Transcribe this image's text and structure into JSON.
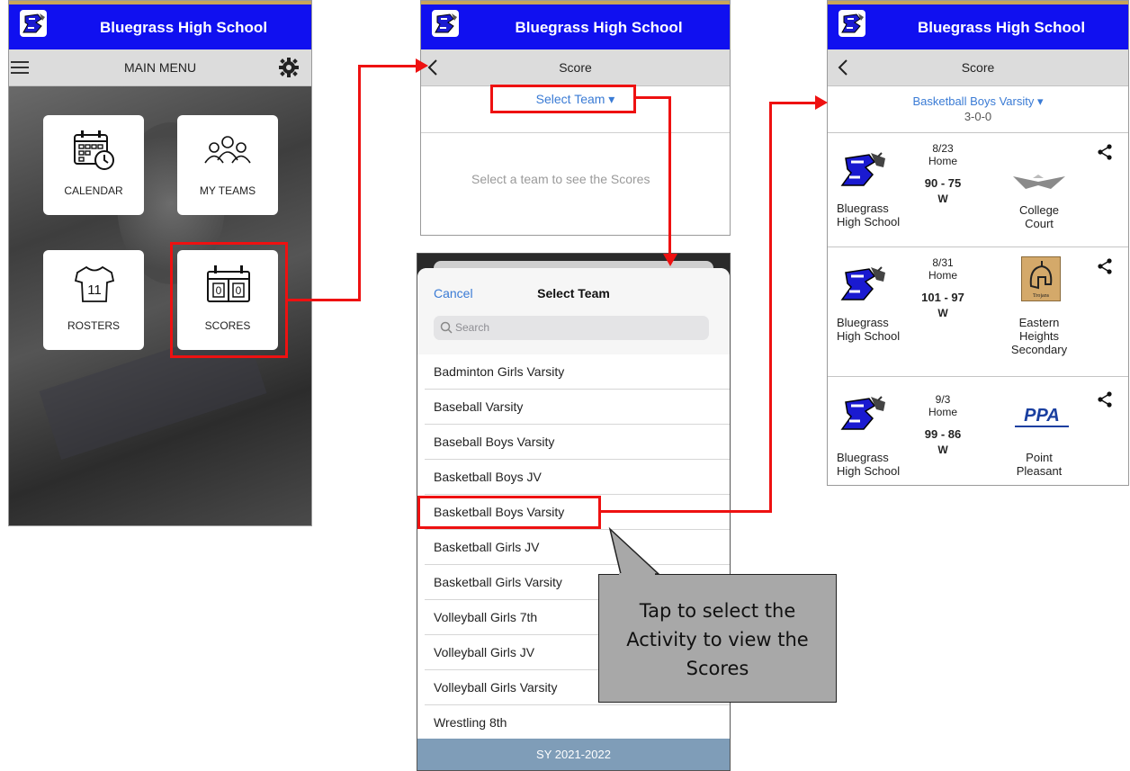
{
  "school": "Bluegrass High School",
  "colors": {
    "header": "#1010f0",
    "accent_red": "#e11111",
    "link_blue": "#3a7bd5",
    "callout": "#a8a8a8",
    "footer": "#7f9db8"
  },
  "screen1": {
    "menu_title": "MAIN MENU",
    "icons": {
      "menu": "hamburger-icon",
      "settings": "gear-icon"
    },
    "tiles": [
      {
        "label": "CALENDAR",
        "icon": "calendar-icon"
      },
      {
        "label": "MY TEAMS",
        "icon": "people-icon"
      },
      {
        "label": "ROSTERS",
        "icon": "jersey-icon"
      },
      {
        "label": "SCORES",
        "icon": "scoreboard-icon"
      }
    ],
    "jersey_number": "11",
    "scoreboard_digits": [
      "0",
      "0"
    ]
  },
  "screen2": {
    "title": "Score",
    "select_label": "Select Team ▾",
    "empty_message": "Select a team to see the Scores"
  },
  "picker": {
    "cancel": "Cancel",
    "title": "Select Team",
    "search_placeholder": "Search",
    "teams": [
      "Badminton Girls Varsity",
      "Baseball Varsity",
      "Baseball Boys Varsity",
      "Basketball Boys JV",
      "Basketball Boys Varsity",
      "Basketball Girls JV",
      "Basketball Girls Varsity",
      "Volleyball Girls 7th",
      "Volleyball Girls JV",
      "Volleyball Girls Varsity",
      "Wrestling 8th"
    ],
    "footer": "SY 2021-2022"
  },
  "callout": {
    "text": "Tap to select the Activity to view the Scores"
  },
  "screen3": {
    "title": "Score",
    "team_label": "Basketball Boys Varsity ▾",
    "record": "3-0-0",
    "games": [
      {
        "date": "8/23",
        "location": "Home",
        "score": "90 - 75",
        "result": "W",
        "home_team": "Bluegrass High School",
        "opponent": "College Court"
      },
      {
        "date": "8/31",
        "location": "Home",
        "score": "101 - 97",
        "result": "W",
        "home_team": "Bluegrass High School",
        "opponent": "Eastern Heights Secondary",
        "opponent_logo_text": "Trojans"
      },
      {
        "date": "9/3",
        "location": "Home",
        "score": "99 - 86",
        "result": "W",
        "home_team": "Bluegrass High School",
        "opponent": "Point Pleasant",
        "opponent_logo_text": "PPA"
      }
    ]
  }
}
